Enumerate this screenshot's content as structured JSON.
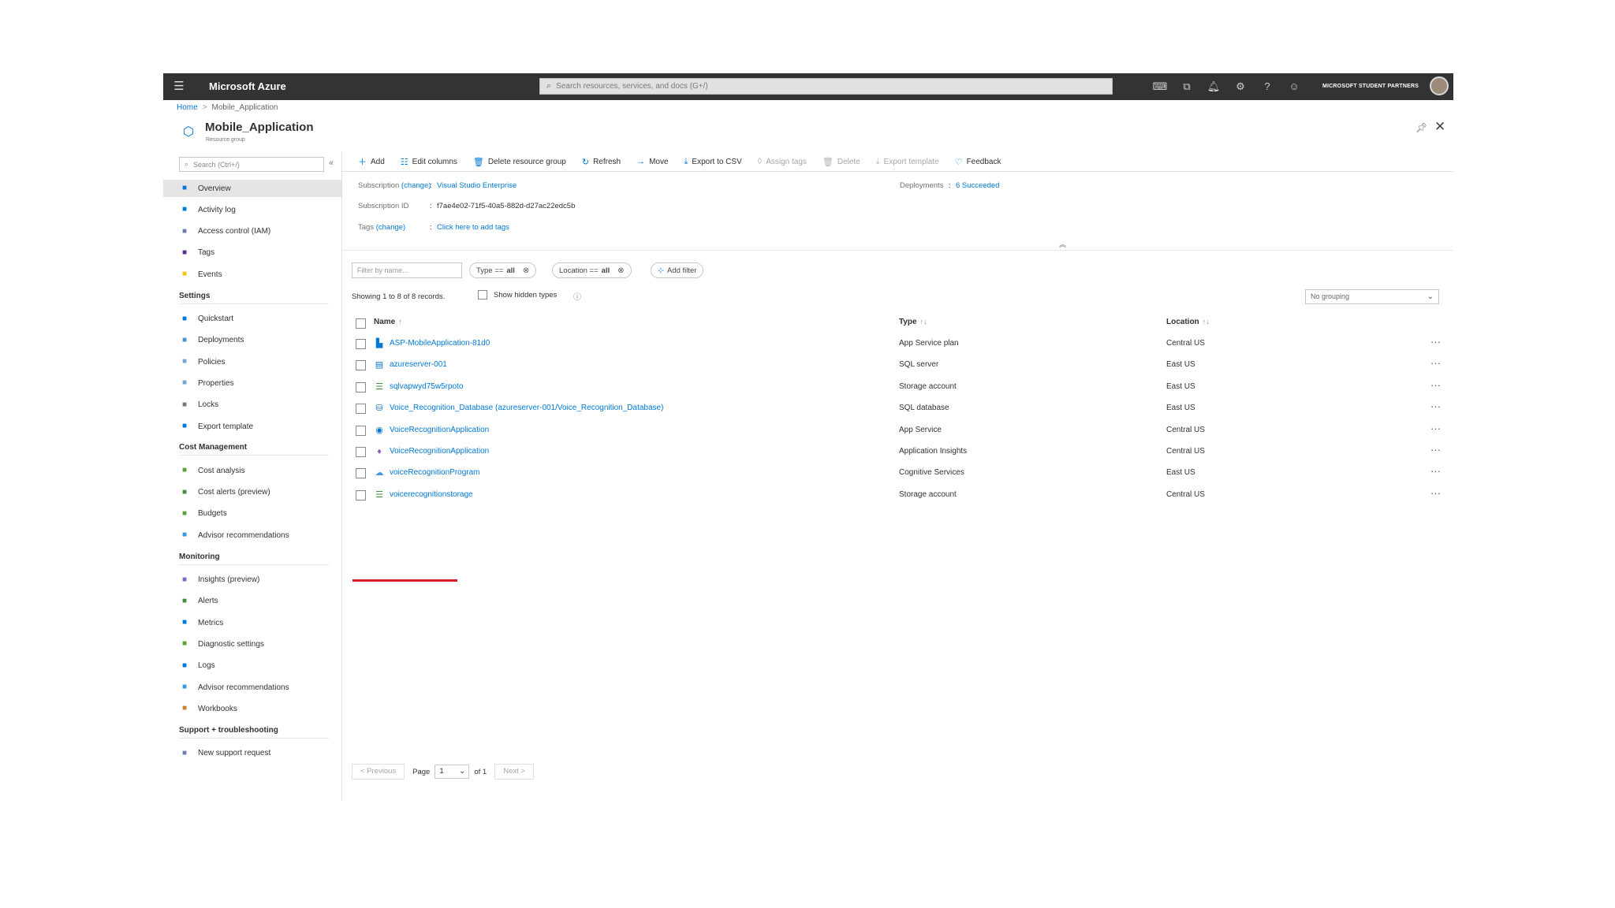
{
  "topbar": {
    "brand": "Microsoft Azure",
    "search_placeholder": "Search resources, services, and docs (G+/)",
    "account": "MICROSOFT STUDENT PARTNERS",
    "icons": [
      "cloud-shell-icon",
      "directory-filter-icon",
      "notifications-icon",
      "settings-icon",
      "help-icon",
      "feedback-smiley-icon"
    ]
  },
  "breadcrumb": {
    "home": "Home",
    "sep": ">",
    "current": "Mobile_Application"
  },
  "header": {
    "title": "Mobile_Application",
    "subtitle": "Resource group"
  },
  "sidebar": {
    "search_placeholder": "Search (Ctrl+/)",
    "top_items": [
      {
        "label": "Overview",
        "icon": "overview-icon",
        "color": "#0078d4"
      },
      {
        "label": "Activity log",
        "icon": "activity-log-icon",
        "color": "#0078d4"
      },
      {
        "label": "Access control (IAM)",
        "icon": "iam-icon",
        "color": "#6b7fa8"
      },
      {
        "label": "Tags",
        "icon": "tag-icon",
        "color": "#5c2d91"
      },
      {
        "label": "Events",
        "icon": "events-icon",
        "color": "#f2c811"
      }
    ],
    "settings_header": "Settings",
    "settings_items": [
      {
        "label": "Quickstart",
        "icon": "quickstart-icon",
        "color": "#0078d4"
      },
      {
        "label": "Deployments",
        "icon": "deployments-icon",
        "color": "#4a8fd4"
      },
      {
        "label": "Policies",
        "icon": "policies-icon",
        "color": "#7aa6d6"
      },
      {
        "label": "Properties",
        "icon": "properties-icon",
        "color": "#7aa6d6"
      },
      {
        "label": "Locks",
        "icon": "lock-icon",
        "color": "#777"
      },
      {
        "label": "Export template",
        "icon": "export-template-icon",
        "color": "#0078d4"
      }
    ],
    "cost_header": "Cost Management",
    "cost_items": [
      {
        "label": "Cost analysis",
        "icon": "cost-analysis-icon",
        "color": "#5ea03e"
      },
      {
        "label": "Cost alerts (preview)",
        "icon": "cost-alerts-icon",
        "color": "#3e8f3e"
      },
      {
        "label": "Budgets",
        "icon": "budgets-icon",
        "color": "#5ea03e"
      },
      {
        "label": "Advisor recommendations",
        "icon": "advisor-icon",
        "color": "#3a96dd"
      }
    ],
    "monitoring_header": "Monitoring",
    "monitoring_items": [
      {
        "label": "Insights (preview)",
        "icon": "insights-icon",
        "color": "#8661c5"
      },
      {
        "label": "Alerts",
        "icon": "alerts-icon",
        "color": "#3e8f3e"
      },
      {
        "label": "Metrics",
        "icon": "metrics-icon",
        "color": "#0078d4"
      },
      {
        "label": "Diagnostic settings",
        "icon": "diagnostic-icon",
        "color": "#5ea03e"
      },
      {
        "label": "Logs",
        "icon": "logs-icon",
        "color": "#0078d4"
      },
      {
        "label": "Advisor recommendations",
        "icon": "advisor-icon",
        "color": "#3a96dd"
      },
      {
        "label": "Workbooks",
        "icon": "workbooks-icon",
        "color": "#c7852b"
      }
    ],
    "support_header": "Support + troubleshooting",
    "support_items": [
      {
        "label": "New support request",
        "icon": "support-icon",
        "color": "#6b7fa8"
      }
    ]
  },
  "toolbar": {
    "add": "Add",
    "edit_columns": "Edit columns",
    "delete_rg": "Delete resource group",
    "refresh": "Refresh",
    "move": "Move",
    "export_csv": "Export to CSV",
    "assign_tags": "Assign tags",
    "delete": "Delete",
    "export_template": "Export template",
    "feedback": "Feedback"
  },
  "essentials": {
    "subscription_label": "Subscription",
    "change": "(change)",
    "subscription_value": "Visual Studio Enterprise",
    "subscription_id_label": "Subscription ID",
    "subscription_id_value": "f7ae4e02-71f5-40a5-882d-d27ac22edc5b",
    "tags_label": "Tags",
    "tags_value": "Click here to add tags",
    "deployments_label": "Deployments",
    "deployments_value": "6 Succeeded",
    "colon": ":"
  },
  "filters": {
    "name_placeholder": "Filter by name...",
    "type_prefix": "Type ==",
    "type_value": "all",
    "location_prefix": "Location ==",
    "location_value": "all",
    "add_filter": "Add filter",
    "showing": "Showing 1 to 8 of 8 records.",
    "show_hidden": "Show hidden types",
    "grouping": "No grouping"
  },
  "table": {
    "headers": {
      "name": "Name",
      "type": "Type",
      "location": "Location"
    },
    "rows": [
      {
        "name": "ASP-MobileApplication-81d0",
        "type": "App Service plan",
        "location": "Central US",
        "icon": "app-service-plan-icon",
        "glyph": "▙",
        "color": "#0078d4"
      },
      {
        "name": "azureserver-001",
        "type": "SQL server",
        "location": "East US",
        "icon": "sql-server-icon",
        "glyph": "▤",
        "color": "#0072c6"
      },
      {
        "name": "sqlvapwyd75w5rpoto",
        "type": "Storage account",
        "location": "East US",
        "icon": "storage-account-icon",
        "glyph": "☰",
        "color": "#3e8f3e"
      },
      {
        "name": "Voice_Recognition_Database (azureserver-001/Voice_Recognition_Database)",
        "type": "SQL database",
        "location": "East US",
        "icon": "sql-database-icon",
        "glyph": "⛁",
        "color": "#0072c6"
      },
      {
        "name": "VoiceRecognitionApplication",
        "type": "App Service",
        "location": "Central US",
        "icon": "app-service-icon",
        "glyph": "◉",
        "color": "#0078d4"
      },
      {
        "name": "VoiceRecognitionApplication",
        "type": "Application Insights",
        "location": "Central US",
        "icon": "app-insights-icon",
        "glyph": "♦",
        "color": "#8661c5"
      },
      {
        "name": "voiceRecognitionProgram",
        "type": "Cognitive Services",
        "location": "East US",
        "icon": "cognitive-services-icon",
        "glyph": "☁",
        "color": "#3a96dd"
      },
      {
        "name": "voicerecognitionstorage",
        "type": "Storage account",
        "location": "Central US",
        "icon": "storage-account-icon",
        "glyph": "☰",
        "color": "#3e8f3e"
      }
    ],
    "more": "···"
  },
  "pager": {
    "previous": "< Previous",
    "page": "Page",
    "page_value": "1",
    "of": "of 1",
    "next": "Next >"
  }
}
